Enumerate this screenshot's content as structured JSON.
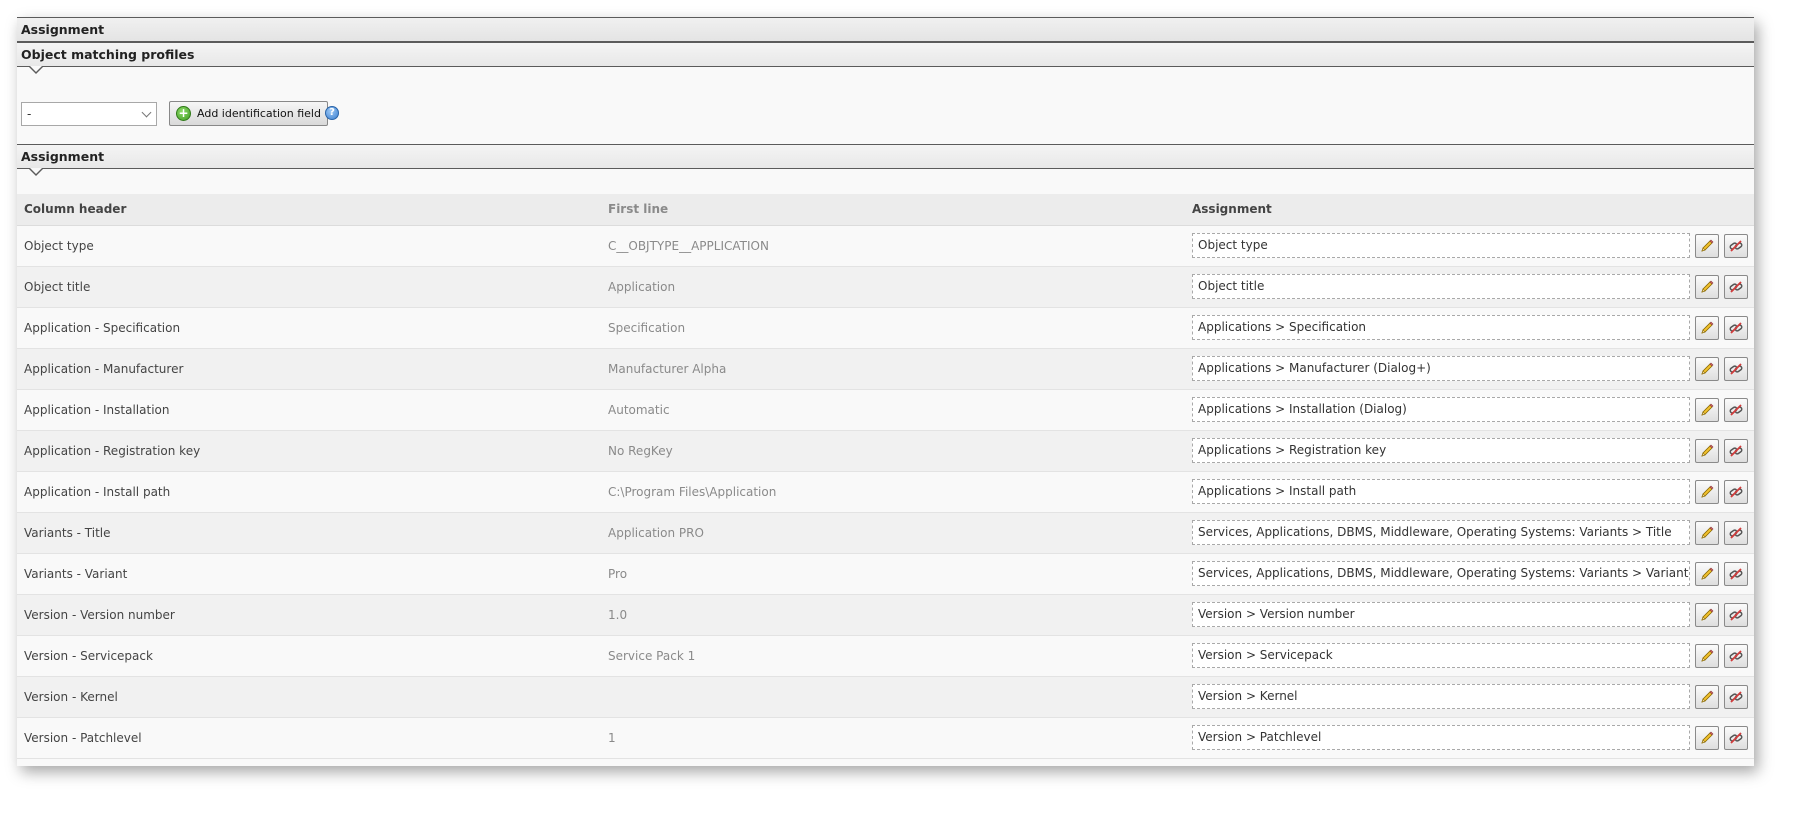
{
  "sections": {
    "top_title": "Assignment",
    "profiles_title": "Object matching profiles",
    "assignment_title": "Assignment"
  },
  "profiles": {
    "select_value": "-",
    "add_button_label": "Add identification field"
  },
  "table": {
    "headers": {
      "column_header": "Column header",
      "first_line": "First line",
      "assignment": "Assignment"
    },
    "rows": [
      {
        "column": "Object type",
        "first": "C__OBJTYPE__APPLICATION",
        "assignment": "Object type"
      },
      {
        "column": "Object title",
        "first": "Application",
        "assignment": "Object title"
      },
      {
        "column": "Application - Specification",
        "first": "Specification",
        "assignment": "Applications > Specification"
      },
      {
        "column": "Application - Manufacturer",
        "first": "Manufacturer Alpha",
        "assignment": "Applications > Manufacturer (Dialog+)"
      },
      {
        "column": "Application - Installation",
        "first": "Automatic",
        "assignment": "Applications > Installation (Dialog)"
      },
      {
        "column": "Application - Registration key",
        "first": "No RegKey",
        "assignment": "Applications > Registration key"
      },
      {
        "column": "Application - Install path",
        "first": "C:\\Program Files\\Application",
        "assignment": "Applications > Install path"
      },
      {
        "column": "Variants - Title",
        "first": "Application PRO",
        "assignment": "Services, Applications, DBMS, Middleware, Operating Systems: Variants > Title"
      },
      {
        "column": "Variants - Variant",
        "first": "Pro",
        "assignment": "Services, Applications, DBMS, Middleware, Operating Systems: Variants > Variant"
      },
      {
        "column": "Version - Version number",
        "first": "1.0",
        "assignment": "Version > Version number"
      },
      {
        "column": "Version - Servicepack",
        "first": "Service Pack 1",
        "assignment": "Version > Servicepack"
      },
      {
        "column": "Version - Kernel",
        "first": "",
        "assignment": "Version > Kernel"
      },
      {
        "column": "Version - Patchlevel",
        "first": "1",
        "assignment": "Version > Patchlevel"
      }
    ]
  },
  "icons": {
    "add": "plus-circle-icon",
    "help": "help-icon",
    "edit": "pencil-icon",
    "detach": "unlink-icon"
  },
  "colors": {
    "section_border": "#5b5b5b",
    "header_text": "#444444",
    "muted_text": "#8a8a8a"
  }
}
